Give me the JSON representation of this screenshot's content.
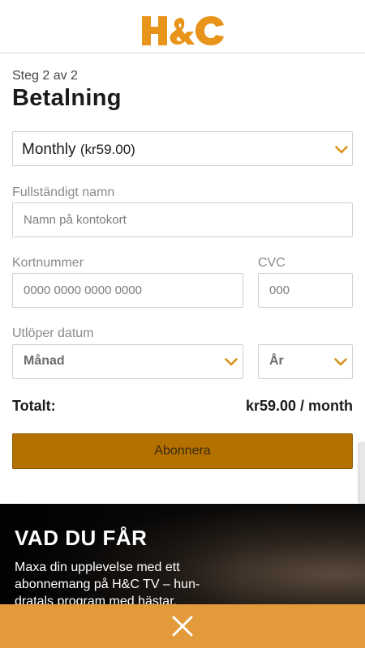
{
  "header": {
    "logo_text": "H&C",
    "brand_color": "#E8941A"
  },
  "checkout": {
    "step": "Steg 2 av 2",
    "title": "Betalning",
    "plan": {
      "name": "Monthly",
      "price": "(kr59.00)"
    },
    "full_name": {
      "label": "Fullständigt namn",
      "placeholder": "Namn på kontokort"
    },
    "card_number": {
      "label": "Kortnummer",
      "placeholder": "0000 0000 0000 0000"
    },
    "cvc": {
      "label": "CVC",
      "placeholder": "000"
    },
    "expiry": {
      "label": "Utlöper datum",
      "month_placeholder": "Månad",
      "year_placeholder": "År"
    },
    "total": {
      "label": "Totalt:",
      "value": "kr59.00 / month"
    },
    "subscribe_label": "Abonnera"
  },
  "promo": {
    "title": "VAD DU FÅR",
    "text_lines": [
      "Maxa din upplevelse med ett",
      "abonnemang på H&C TV – hun-",
      "dratals program med hästar,"
    ]
  },
  "close_bar": {
    "icon": "close-icon",
    "color": "#E29A3B"
  },
  "colors": {
    "accent": "#E8941A",
    "button": "#B47100",
    "chevron": "#D9921A"
  }
}
